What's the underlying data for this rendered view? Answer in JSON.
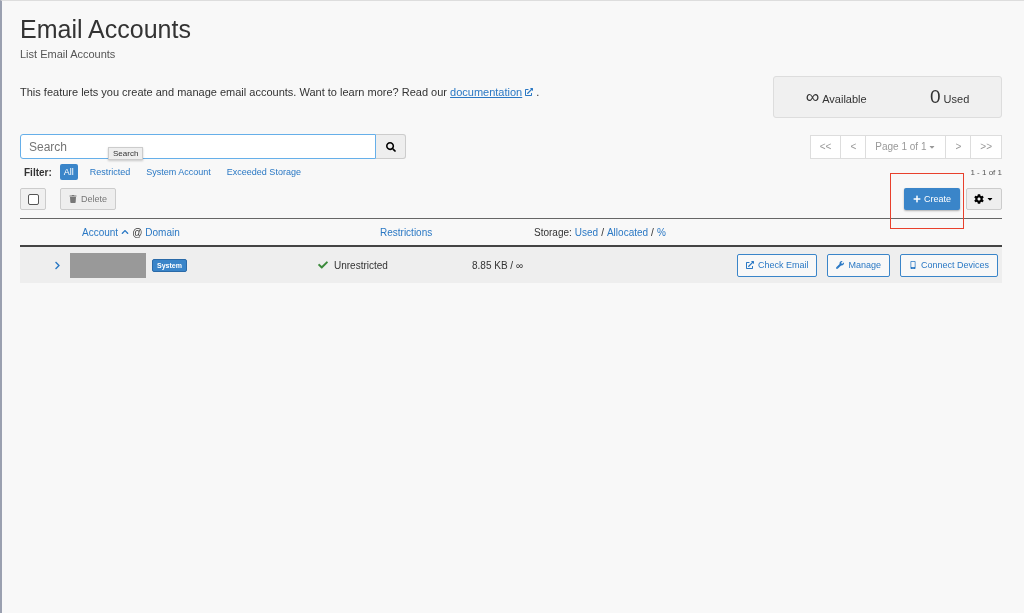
{
  "page": {
    "title": "Email Accounts",
    "subtitle": "List Email Accounts",
    "description": "This feature lets you create and manage email accounts. Want to learn more? Read our",
    "link": "documentation",
    "after": "."
  },
  "stats": [
    {
      "value": "∞",
      "label": "Available"
    },
    {
      "value": "0",
      "label": "Used"
    }
  ],
  "search": {
    "placeholder": "Search",
    "tooltip": "Search"
  },
  "pagination": {
    "first": "<<",
    "prev": "<",
    "page": "Page 1 of 1",
    "next": ">",
    "last": ">>",
    "range": "1 - 1 of 1"
  },
  "filter": {
    "label": "Filter:",
    "options": [
      {
        "label": "All",
        "selected": true
      },
      {
        "label": "Restricted",
        "selected": false
      },
      {
        "label": "System Account",
        "selected": false
      },
      {
        "label": "Exceeded Storage",
        "selected": false
      }
    ]
  },
  "toolbar": {
    "select_all_checked": false,
    "delete": "Delete",
    "create": "Create",
    "create_highlighted": true
  },
  "table": {
    "account_column": {
      "account": "Account",
      "at": "@",
      "domain": "Domain"
    },
    "restrictions_column": "Restrictions",
    "storage_column": [
      {
        "kind": "plain",
        "text": "Storage:"
      },
      {
        "kind": "link",
        "text": "Used"
      },
      {
        "kind": "plain",
        "text": "/"
      },
      {
        "kind": "link",
        "text": "Allocated"
      },
      {
        "kind": "plain",
        "text": "/"
      },
      {
        "kind": "link",
        "text": "%"
      }
    ],
    "rows": [
      {
        "expanded": false,
        "badge": "System",
        "restricted": false,
        "restriction": "Unrestricted",
        "storage": "8.85 KB / ∞",
        "actions": [
          {
            "kind": "check",
            "label": "Check Email"
          },
          {
            "kind": "manage",
            "label": "Manage"
          },
          {
            "kind": "devices",
            "label": "Connect Devices"
          }
        ]
      }
    ]
  }
}
